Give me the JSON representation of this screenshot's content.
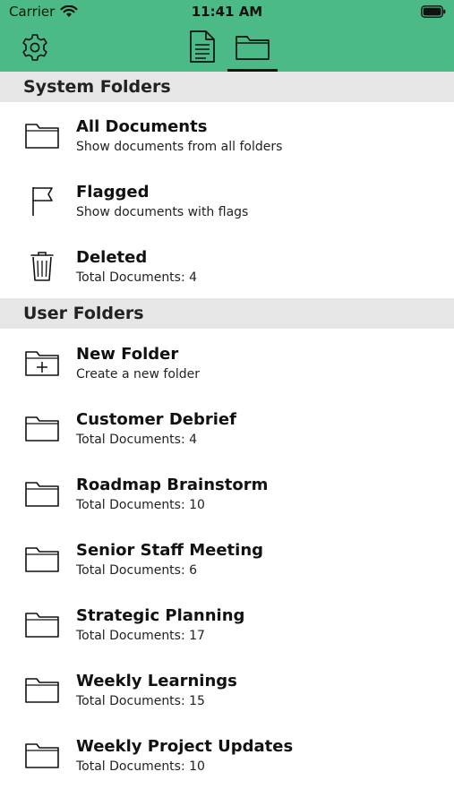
{
  "status_bar": {
    "carrier": "Carrier",
    "time": "11:41 AM"
  },
  "toolbar": {
    "settings_icon": "gear-icon",
    "tabs": [
      {
        "icon": "document-icon",
        "selected": false
      },
      {
        "icon": "folder-icon",
        "selected": true
      }
    ]
  },
  "colors": {
    "header_green": "#4cba86",
    "section_gray": "#e6e6e6"
  },
  "system_folders": {
    "header": "System Folders",
    "items": [
      {
        "icon": "folder-icon",
        "title": "All Documents",
        "subtitle": "Show documents from all folders"
      },
      {
        "icon": "flag-icon",
        "title": "Flagged",
        "subtitle": "Show documents with flags"
      },
      {
        "icon": "trash-icon",
        "title": "Deleted",
        "subtitle": "Total Documents: 4"
      }
    ]
  },
  "user_folders": {
    "header": "User Folders",
    "items": [
      {
        "icon": "folder-plus-icon",
        "title": "New Folder",
        "subtitle": "Create a new folder"
      },
      {
        "icon": "folder-icon",
        "title": "Customer Debrief",
        "subtitle": "Total Documents: 4"
      },
      {
        "icon": "folder-icon",
        "title": "Roadmap Brainstorm",
        "subtitle": "Total Documents: 10"
      },
      {
        "icon": "folder-icon",
        "title": "Senior Staff Meeting",
        "subtitle": "Total Documents: 6"
      },
      {
        "icon": "folder-icon",
        "title": "Strategic Planning",
        "subtitle": "Total Documents: 17"
      },
      {
        "icon": "folder-icon",
        "title": "Weekly Learnings",
        "subtitle": "Total Documents: 15"
      },
      {
        "icon": "folder-icon",
        "title": "Weekly Project Updates",
        "subtitle": "Total Documents: 10"
      }
    ]
  }
}
